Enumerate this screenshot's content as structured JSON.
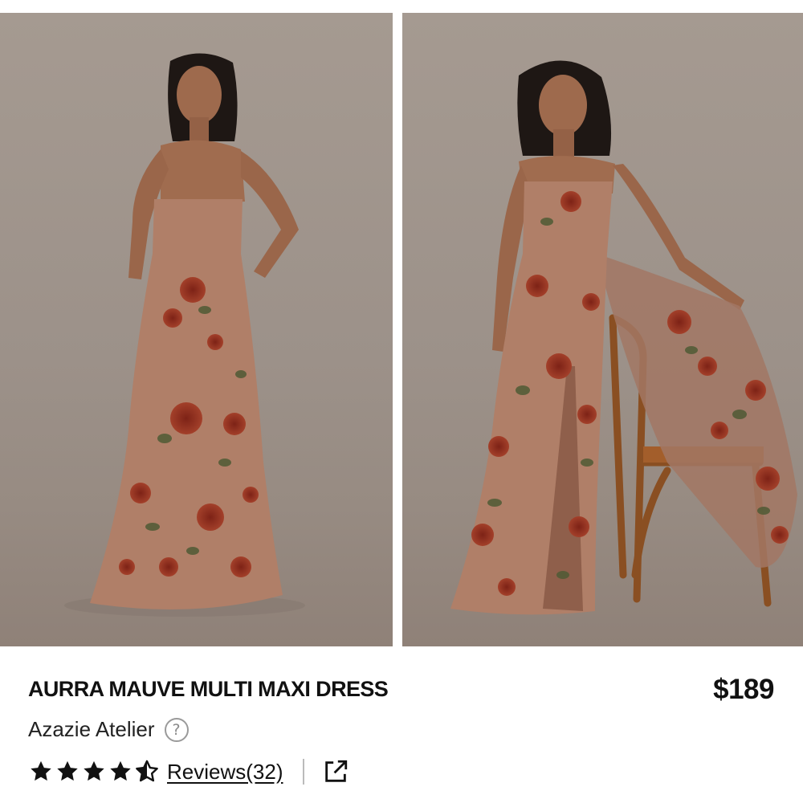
{
  "product": {
    "title": "AURRA MAUVE MULTI MAXI DRESS",
    "price": "$189",
    "brand": "Azazie Atelier",
    "rating": 4.5,
    "rating_max": 5,
    "reviews_label": "Reviews(32)"
  },
  "icons": {
    "help": "question-circle-icon",
    "rating": "star-icon",
    "share": "external-link-icon"
  },
  "colors": {
    "text": "#111111",
    "star": "#111111",
    "background": "#ffffff"
  }
}
